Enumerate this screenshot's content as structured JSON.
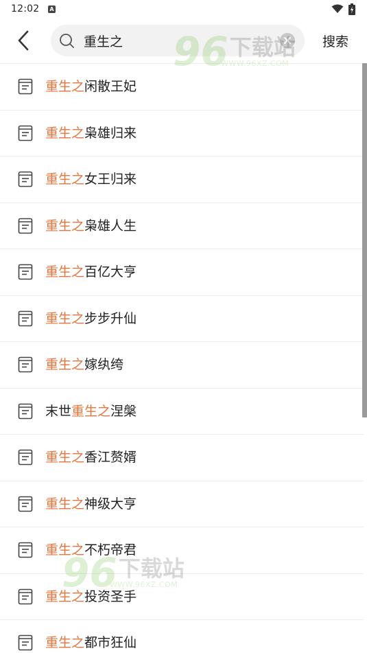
{
  "status_bar": {
    "time": "12:02",
    "notification_icon": "a-icon",
    "wifi_icon": "wifi-icon",
    "battery_icon": "battery-icon"
  },
  "header": {
    "back_icon": "chevron-left-icon",
    "search": {
      "value": "重生之",
      "placeholder": ""
    },
    "search_button_label": "搜索"
  },
  "highlight_color": "#e8743d",
  "suggestions": [
    {
      "pre": "",
      "hl": "重生之",
      "post": "闲散王妃"
    },
    {
      "pre": "",
      "hl": "重生之",
      "post": "枭雄归来"
    },
    {
      "pre": "",
      "hl": "重生之",
      "post": "女王归来"
    },
    {
      "pre": "",
      "hl": "重生之",
      "post": "枭雄人生"
    },
    {
      "pre": "",
      "hl": "重生之",
      "post": "百亿大亨"
    },
    {
      "pre": "",
      "hl": "重生之",
      "post": "步步升仙"
    },
    {
      "pre": "",
      "hl": "重生之",
      "post": "嫁纨绔"
    },
    {
      "pre": "末世",
      "hl": "重生之",
      "post": "涅槃"
    },
    {
      "pre": "",
      "hl": "重生之",
      "post": "香江赘婿"
    },
    {
      "pre": "",
      "hl": "重生之",
      "post": "神级大亨"
    },
    {
      "pre": "",
      "hl": "重生之",
      "post": "不朽帝君"
    },
    {
      "pre": "",
      "hl": "重生之",
      "post": "投资圣手"
    },
    {
      "pre": "",
      "hl": "重生之",
      "post": "都市狂仙"
    }
  ],
  "watermark": {
    "logo": "96",
    "name": "下载站",
    "url": "WWW.96XZ.COM"
  }
}
